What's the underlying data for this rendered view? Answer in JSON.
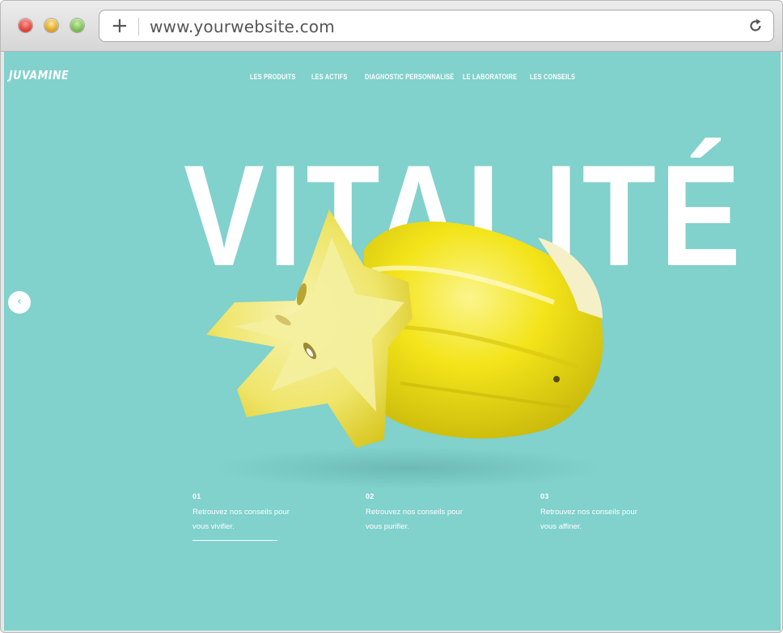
{
  "browser": {
    "url": "www.yourwebsite.com",
    "plus_glyph": "+",
    "icons": [
      "close-icon",
      "minimize-icon",
      "zoom-icon",
      "new-tab-icon",
      "reload-icon"
    ]
  },
  "site": {
    "logo": "JUVAMINE",
    "nav": [
      {
        "label": "LES PRODUITS"
      },
      {
        "label": "LES ACTIFS"
      },
      {
        "label": "DIAGNOSTIC PERSONNALISÉ"
      },
      {
        "label": "LE LABORATOIRE"
      },
      {
        "label": "LES CONSEILS"
      }
    ],
    "hero_word": "VITALITÉ",
    "prev_arrow": "‹",
    "tips": [
      {
        "number": "01",
        "text": "Retrouvez nos conseils pour vous vivifier.",
        "active": true
      },
      {
        "number": "02",
        "text": "Retrouvez nos conseils pour vous purifier.",
        "active": false
      },
      {
        "number": "03",
        "text": "Retrouvez nos conseils pour vous affiner.",
        "active": false
      }
    ]
  },
  "colors": {
    "page_background": "#81d1cc",
    "fruit_yellow": "#f2e21a",
    "text_white": "#ffffff"
  }
}
